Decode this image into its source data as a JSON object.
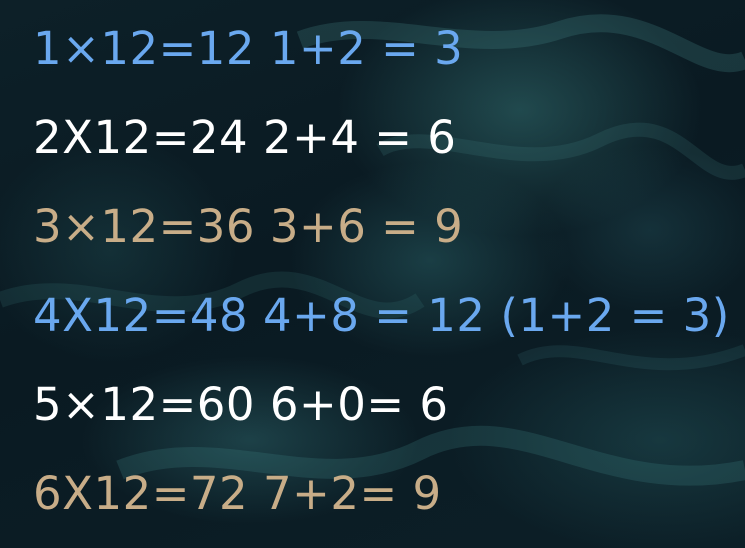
{
  "lines": [
    {
      "text": "1×12=12 1+2 = 3",
      "color": "#6aa8ef"
    },
    {
      "text": "2X12=24 2+4 = 6",
      "color": "#ffffff"
    },
    {
      "text": "3×12=36 3+6 = 9",
      "color": "#c8ad88"
    },
    {
      "text": "4X12=48 4+8 = 12 (1+2 = 3)",
      "color": "#6aa8ef"
    },
    {
      "text": "5×12=60 6+0= 6",
      "color": "#ffffff"
    },
    {
      "text": "6X12=72 7+2= 9",
      "color": "#c8ad88"
    }
  ]
}
